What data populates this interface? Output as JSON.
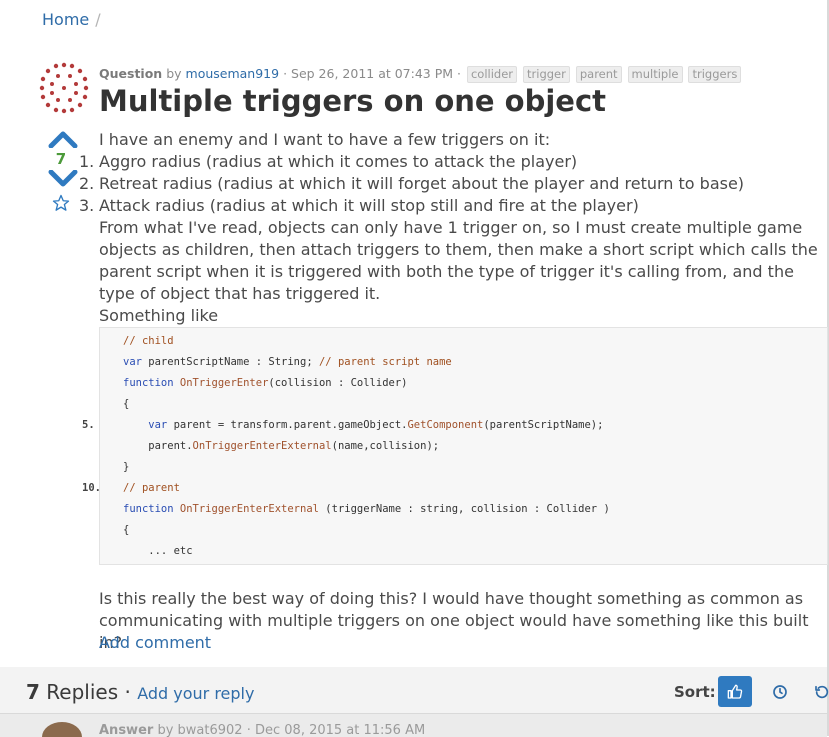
{
  "breadcrumb": {
    "home": "Home",
    "sep": "/"
  },
  "question": {
    "type_label": "Question",
    "by": "by",
    "author": "mouseman919",
    "date": "· Sep 26, 2011 at 07:43 PM ·",
    "tags": [
      "collider",
      "trigger",
      "parent",
      "multiple",
      "triggers"
    ],
    "title": "Multiple triggers on one object",
    "votes": "7",
    "intro": "I have an enemy and I want to have a few triggers on it:",
    "list": [
      {
        "num": "1.",
        "text": "Aggro radius (radius at which it comes to attack the player)"
      },
      {
        "num": "2.",
        "text": "Retreat radius (radius at which it will forget about the player and return to base)"
      },
      {
        "num": "3.",
        "text": "Attack radius (radius at which it will stop still and fire at the player)"
      }
    ],
    "paragraph": "From what I've read, objects can only have 1 trigger on, so I must create multiple game objects as children, then attach triggers to them, then make a short script which calls the parent script when it is triggered with both the type of trigger it's calling from, and the type of object that has triggered it.",
    "something_like": "Something like",
    "code": {
      "l1": "// child",
      "l2a": "var",
      "l2b": " parentScriptName : String; ",
      "l2c": "// parent script name",
      "l3a": "function",
      "l3b": " OnTriggerEnter",
      "l3c": "(collision : Collider)",
      "l4": "{",
      "l5no": "5.",
      "l5a": "    var",
      "l5b": " parent = transform.parent.gameObject.",
      "l5c": "GetComponent",
      "l5d": "(parentScriptName);",
      "l6a": "    parent.",
      "l6b": "OnTriggerEnterExternal",
      "l6c": "(name,collision);",
      "l7": "}",
      "l8no": "10.",
      "l8": "// parent",
      "l9a": "function",
      "l9b": " OnTriggerEnterExternal",
      "l9c": " (triggerName : string, collision : Collider )",
      "l10": "{",
      "l11": "    ... etc"
    },
    "closing": "Is this really the best way of doing this? I would have thought something as common as communicating with multiple triggers on one object would have something like this built in?",
    "add_comment": "Add comment"
  },
  "replies": {
    "count": "7",
    "label": " Replies",
    "dot": " · ",
    "add_reply": "Add your reply",
    "sort_label": "Sort:"
  },
  "answer": {
    "type_label": "Answer",
    "by": "by",
    "author": "bwat6902",
    "date": "· Dec 08, 2015 at 11:56 AM"
  },
  "colors": {
    "link": "#2f6ca8",
    "accent": "#2f7ac0",
    "vote_count": "#4c9a3a",
    "avatar": "#b33a3a"
  },
  "icons": [
    "upvote-icon",
    "downvote-icon",
    "star-icon",
    "thumbs-up-icon",
    "clock-icon",
    "history-icon",
    "avatar-icon"
  ]
}
